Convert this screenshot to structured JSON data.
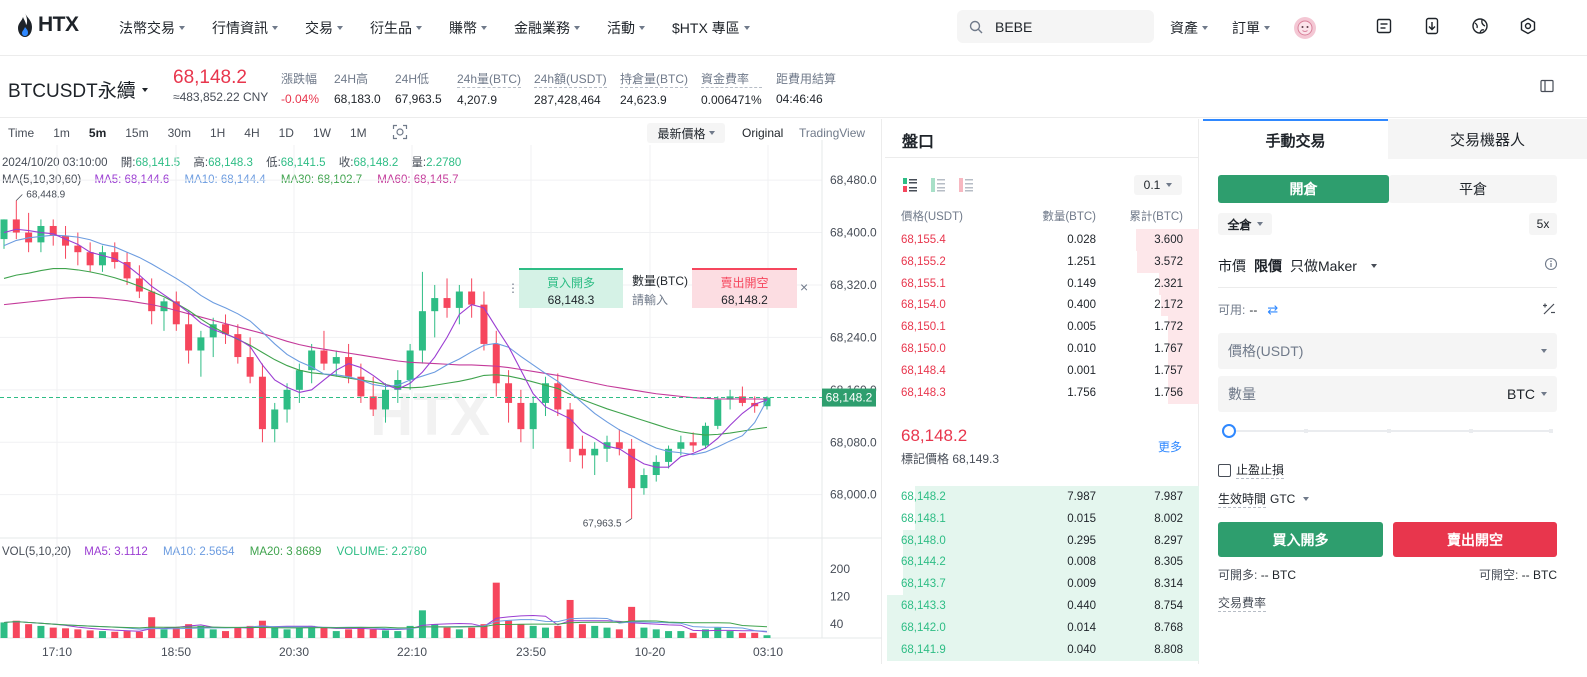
{
  "brand": {
    "name": "HTX",
    "watermark": "HTX"
  },
  "nav": {
    "items": [
      "法幣交易",
      "行情資訊",
      "交易",
      "衍生品",
      "賺幣",
      "金融業務",
      "活動",
      "$HTX 專區"
    ]
  },
  "search": {
    "value": "BEBE"
  },
  "right_nav": {
    "assets": "資產",
    "orders": "訂單"
  },
  "ticker": {
    "symbol": "BTCUSDT永續",
    "last_price": "68,148.2",
    "cny": "≈483,852.22 CNY",
    "stats": [
      {
        "label": "漲跌幅",
        "value": "-0.04%",
        "dashed": false,
        "color": "#e8364d"
      },
      {
        "label": "24H高",
        "value": "68,183.0",
        "dashed": false,
        "color": "#1e2329"
      },
      {
        "label": "24H低",
        "value": "67,963.5",
        "dashed": false,
        "color": "#1e2329"
      },
      {
        "label": "24h量(BTC)",
        "value": "4,207.9",
        "dashed": true,
        "color": "#1e2329"
      },
      {
        "label": "24h額(USDT)",
        "value": "287,428,464",
        "dashed": true,
        "color": "#1e2329"
      },
      {
        "label": "持倉量(BTC)",
        "value": "24,623.9",
        "dashed": true,
        "color": "#1e2329"
      },
      {
        "label": "資金費率",
        "value": "0.006471%",
        "dashed": true,
        "color": "#1e2329"
      },
      {
        "label": "距費用結算",
        "value": "04:46:46",
        "dashed": false,
        "color": "#1e2329"
      }
    ]
  },
  "chart": {
    "intervals": [
      "Time",
      "1m",
      "5m",
      "15m",
      "30m",
      "1H",
      "4H",
      "1D",
      "1W",
      "1M"
    ],
    "active_interval": "5m",
    "price_type": "最新價格",
    "views": [
      "Original",
      "TradingView"
    ],
    "info_line": {
      "date": "2024/10/20 03:10:00",
      "open_label": "開:",
      "open": "68,141.5",
      "high_label": "高:",
      "high": "68,148.3",
      "low_label": "低:",
      "low": "68,141.5",
      "close_label": "收:",
      "close": "68,148.2",
      "vol_label": "量:",
      "vol": "2.2780"
    },
    "ma_line": {
      "title": "MA(5,10,30,60)",
      "ma5": "MA5: 68,144.6",
      "ma10": "MA10: 68,144.4",
      "ma30": "MA30: 68,102.7",
      "ma60": "MA60: 68,145.7"
    },
    "vol_line": {
      "title": "VOL(5,10,20)",
      "ma5": "MA5: 3.1112",
      "ma10": "MA10: 2.5654",
      "ma20": "MA20: 3.8689",
      "volume": "VOLUME: 2.2780"
    },
    "max_label": "68,448.9",
    "min_label": "67,963.5",
    "current_price": "68,148.2",
    "quick_order": {
      "buy_label": "買入開多",
      "buy_price": "68,148.3",
      "qty_label": "數量(BTC)",
      "qty_placeholder": "請輸入",
      "sell_label": "賣出開空",
      "sell_price": "68,148.2"
    },
    "colors": {
      "up": "#2ebd85",
      "down": "#f6465d",
      "ma5": "#9b3dd2",
      "ma10": "#6c9ce0",
      "ma30": "#3fa34d",
      "ma60": "#c43a9a"
    }
  },
  "chart_data": {
    "type": "candlestick",
    "x_ticks": [
      "17:10",
      "18:50",
      "20:30",
      "22:10",
      "23:50",
      "10-20",
      "03:10"
    ],
    "y_ticks": [
      "68,480.0",
      "68,400.0",
      "68,320.0",
      "68,240.0",
      "68,160.0",
      "68,080.0",
      "68,000.0"
    ],
    "y_range": [
      67940,
      68500
    ],
    "vol_ticks": [
      "200",
      "120",
      "40"
    ],
    "vol_range": [
      0,
      240
    ],
    "candles": [
      [
        68390,
        68420,
        68375,
        68420,
        45
      ],
      [
        68420,
        68448.9,
        68390,
        68400,
        50
      ],
      [
        68400,
        68430,
        68370,
        68385,
        40
      ],
      [
        68385,
        68420,
        68370,
        68410,
        35
      ],
      [
        68410,
        68420,
        68380,
        68395,
        30
      ],
      [
        68395,
        68410,
        68360,
        68380,
        28
      ],
      [
        68380,
        68400,
        68350,
        68370,
        25
      ],
      [
        68370,
        68385,
        68340,
        68350,
        22
      ],
      [
        68350,
        68380,
        68340,
        68370,
        20
      ],
      [
        68370,
        68385,
        68345,
        68355,
        18
      ],
      [
        68355,
        68370,
        68320,
        68330,
        20
      ],
      [
        68330,
        68350,
        68300,
        68310,
        18
      ],
      [
        68310,
        68330,
        68260,
        68280,
        60
      ],
      [
        68280,
        68300,
        68250,
        68295,
        25
      ],
      [
        68295,
        68310,
        68250,
        68260,
        30
      ],
      [
        68260,
        68280,
        68200,
        68220,
        40
      ],
      [
        68220,
        68250,
        68180,
        68240,
        35
      ],
      [
        68240,
        68270,
        68210,
        68260,
        25
      ],
      [
        68260,
        68275,
        68230,
        68245,
        20
      ],
      [
        68245,
        68260,
        68200,
        68210,
        30
      ],
      [
        68210,
        68240,
        68170,
        68180,
        35
      ],
      [
        68180,
        68200,
        68080,
        68100,
        50
      ],
      [
        68100,
        68140,
        68080,
        68130,
        30
      ],
      [
        68130,
        68170,
        68110,
        68160,
        25
      ],
      [
        68160,
        68200,
        68140,
        68190,
        30
      ],
      [
        68190,
        68230,
        68170,
        68220,
        35
      ],
      [
        68220,
        68250,
        68190,
        68200,
        30
      ],
      [
        68200,
        68220,
        68180,
        68210,
        20
      ],
      [
        68210,
        68230,
        68170,
        68180,
        25
      ],
      [
        68180,
        68200,
        68140,
        68150,
        30
      ],
      [
        68150,
        68180,
        68120,
        68130,
        25
      ],
      [
        68130,
        68170,
        68110,
        68160,
        22
      ],
      [
        68160,
        68190,
        68140,
        68175,
        20
      ],
      [
        68175,
        68230,
        68160,
        68220,
        35
      ],
      [
        68220,
        68340,
        68200,
        68280,
        80
      ],
      [
        68280,
        68320,
        68240,
        68300,
        40
      ],
      [
        68300,
        68330,
        68270,
        68285,
        30
      ],
      [
        68285,
        68320,
        68260,
        68310,
        25
      ],
      [
        68310,
        68330,
        68270,
        68290,
        30
      ],
      [
        68290,
        68310,
        68220,
        68230,
        40
      ],
      [
        68230,
        68250,
        68150,
        68170,
        160
      ],
      [
        68170,
        68190,
        68110,
        68140,
        50
      ],
      [
        68140,
        68160,
        68080,
        68100,
        40
      ],
      [
        68100,
        68150,
        68070,
        68140,
        35
      ],
      [
        68140,
        68180,
        68120,
        68170,
        30
      ],
      [
        68170,
        68185,
        68120,
        68130,
        35
      ],
      [
        68130,
        68140,
        68050,
        68070,
        110
      ],
      [
        68070,
        68090,
        68040,
        68060,
        40
      ],
      [
        68060,
        68080,
        68030,
        68070,
        35
      ],
      [
        68070,
        68090,
        68050,
        68080,
        30
      ],
      [
        68080,
        68100,
        68060,
        68070,
        25
      ],
      [
        68070,
        68085,
        67963.5,
        68010,
        90
      ],
      [
        68010,
        68040,
        68000,
        68030,
        30
      ],
      [
        68030,
        68060,
        68020,
        68050,
        25
      ],
      [
        68050,
        68075,
        68040,
        68070,
        20
      ],
      [
        68070,
        68090,
        68060,
        68080,
        20
      ],
      [
        68080,
        68095,
        68065,
        68075,
        15
      ],
      [
        68075,
        68110,
        68070,
        68105,
        25
      ],
      [
        68105,
        68150,
        68100,
        68145,
        30
      ],
      [
        68145,
        68160,
        68130,
        68150,
        20
      ],
      [
        68150,
        68165,
        68135,
        68140,
        15
      ],
      [
        68140,
        68150,
        68125,
        68135,
        15
      ],
      [
        68135,
        68150,
        68130,
        68148.2,
        8
      ]
    ],
    "ma5": [
      68400,
      68405,
      68403,
      68400,
      68398,
      68390,
      68382,
      68370,
      68365,
      68360,
      68350,
      68335,
      68318,
      68305,
      68292,
      68278,
      68262,
      68252,
      68245,
      68238,
      68226,
      68198,
      68175,
      68164,
      68156,
      68160,
      68175,
      68190,
      68200,
      68194,
      68182,
      68168,
      68161,
      68170,
      68187,
      68210,
      68240,
      68275,
      68290,
      68285,
      68255,
      68226,
      68190,
      68154,
      68134,
      68125,
      68116,
      68096,
      68086,
      68074,
      68070,
      68058,
      68047,
      68042,
      68042,
      68058,
      68063,
      68071,
      68086,
      68106,
      68124,
      68138,
      68144.6
    ],
    "ma10": [
      68380,
      68388,
      68392,
      68394,
      68396,
      68395,
      68393,
      68389,
      68382,
      68378,
      68370,
      68362,
      68352,
      68341,
      68330,
      68318,
      68304,
      68293,
      68285,
      68276,
      68265,
      68248,
      68230,
      68214,
      68203,
      68195,
      68184,
      68183,
      68180,
      68175,
      68168,
      68165,
      68167,
      68175,
      68181,
      68187,
      68198,
      68207,
      68218,
      68228,
      68231,
      68225,
      68211,
      68198,
      68185,
      68173,
      68157,
      68140,
      68124,
      68111,
      68099,
      68090,
      68080,
      68071,
      68066,
      68064,
      68061,
      68065,
      68073,
      68082,
      68090,
      68110,
      68144.4
    ],
    "ma30": [
      68330,
      68335,
      68338,
      68342,
      68345,
      68345,
      68343,
      68340,
      68336,
      68331,
      68325,
      68318,
      68310,
      68302,
      68292,
      68281,
      68268,
      68256,
      68246,
      68237,
      68228,
      68217,
      68206,
      68197,
      68190,
      68186,
      68184,
      68181,
      68178,
      68175,
      68172,
      68168,
      68164,
      68163,
      68164,
      68167,
      68170,
      68173,
      68177,
      68182,
      68183,
      68181,
      68177,
      68172,
      68167,
      68162,
      68153,
      68145,
      68138,
      68131,
      68125,
      68119,
      68113,
      68107,
      68101,
      68096,
      68093,
      68091,
      68092,
      68094,
      68097,
      68100,
      68102.7
    ],
    "ma60": [
      68290,
      68292,
      68294,
      68296,
      68298,
      68300,
      68301,
      68301,
      68300,
      68298,
      68296,
      68293,
      68290,
      68286,
      68281,
      68276,
      68271,
      68266,
      68261,
      68256,
      68251,
      68246,
      68240,
      68234,
      68229,
      68225,
      68222,
      68219,
      68216,
      68213,
      68210,
      68207,
      68204,
      68202,
      68201,
      68200,
      68199,
      68198,
      68198,
      68197,
      68196,
      68194,
      68191,
      68188,
      68185,
      68182,
      68178,
      68174,
      68170,
      68166,
      68163,
      68160,
      68157,
      68154,
      68152,
      68150,
      68148,
      68147,
      68146,
      68146,
      68146,
      68146,
      68145.7
    ]
  },
  "orderbook": {
    "title": "盤口",
    "precision": "0.1",
    "headers": {
      "price": "價格(USDT)",
      "qty": "數量(BTC)",
      "total": "累計(BTC)"
    },
    "asks": [
      {
        "price": "68,155.4",
        "qty": "0.028",
        "total": "3.600",
        "depth": 1.0
      },
      {
        "price": "68,155.2",
        "qty": "1.251",
        "total": "3.572",
        "depth": 0.99
      },
      {
        "price": "68,155.1",
        "qty": "0.149",
        "total": "2.321",
        "depth": 0.64
      },
      {
        "price": "68,154.0",
        "qty": "0.400",
        "total": "2.172",
        "depth": 0.6
      },
      {
        "price": "68,150.1",
        "qty": "0.005",
        "total": "1.772",
        "depth": 0.49
      },
      {
        "price": "68,150.0",
        "qty": "0.010",
        "total": "1.767",
        "depth": 0.49
      },
      {
        "price": "68,148.4",
        "qty": "0.001",
        "total": "1.757",
        "depth": 0.49
      },
      {
        "price": "68,148.3",
        "qty": "1.756",
        "total": "1.756",
        "depth": 0.49
      }
    ],
    "mid_price": "68,148.2",
    "mark_price": "標記價格 68,149.3",
    "more": "更多",
    "bids": [
      {
        "price": "68,148.2",
        "qty": "7.987",
        "total": "7.987",
        "depth": 0.91
      },
      {
        "price": "68,148.1",
        "qty": "0.015",
        "total": "8.002",
        "depth": 0.91
      },
      {
        "price": "68,148.0",
        "qty": "0.295",
        "total": "8.297",
        "depth": 0.95
      },
      {
        "price": "68,144.2",
        "qty": "0.008",
        "total": "8.305",
        "depth": 0.95
      },
      {
        "price": "68,143.7",
        "qty": "0.009",
        "total": "8.314",
        "depth": 0.95
      },
      {
        "price": "68,143.3",
        "qty": "0.440",
        "total": "8.754",
        "depth": 1.0
      },
      {
        "price": "68,142.0",
        "qty": "0.014",
        "total": "8.768",
        "depth": 1.0
      },
      {
        "price": "68,141.9",
        "qty": "0.040",
        "total": "8.808",
        "depth": 1.0
      }
    ]
  },
  "trade": {
    "tabs": [
      "手動交易",
      "交易機器人"
    ],
    "open_label": "開倉",
    "close_label": "平倉",
    "margin_mode": "全倉",
    "leverage": "5x",
    "order_types": [
      "市價",
      "限價",
      "只做Maker"
    ],
    "available_label": "可用:",
    "available_value": "--",
    "price_placeholder": "價格(USDT)",
    "qty_label": "數量",
    "qty_unit": "BTC",
    "slider_level": 0,
    "tpsl_label": "止盈止損",
    "tif_label": "生效時間",
    "tif_value": "GTC",
    "buy_button": "買入開多",
    "sell_button": "賣出開空",
    "can_long_label": "可開多:",
    "can_long_value": "-- BTC",
    "can_short_label": "可開空:",
    "can_short_value": "-- BTC",
    "fee_label": "交易費率"
  }
}
